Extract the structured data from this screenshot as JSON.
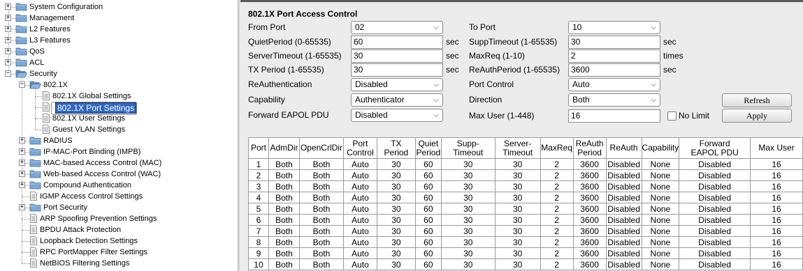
{
  "tree": {
    "items": [
      {
        "label": "System Configuration",
        "icon": "folder-icon"
      },
      {
        "label": "Management",
        "icon": "folder-icon"
      },
      {
        "label": "L2 Features",
        "icon": "folder-icon"
      },
      {
        "label": "L3 Features",
        "icon": "folder-icon"
      },
      {
        "label": "QoS",
        "icon": "folder-icon"
      },
      {
        "label": "ACL",
        "icon": "folder-icon"
      },
      {
        "label": "Security",
        "icon": "folder-open-icon"
      },
      {
        "label": "802.1X",
        "icon": "folder-open-icon"
      },
      {
        "label": "802.1X Global Settings",
        "icon": "document-icon"
      },
      {
        "label": "802.1X Port Settings",
        "icon": "document-icon"
      },
      {
        "label": "802.1X User Settings",
        "icon": "document-icon"
      },
      {
        "label": "Guest VLAN Settings",
        "icon": "document-icon"
      },
      {
        "label": "RADIUS",
        "icon": "folder-icon"
      },
      {
        "label": "IP-MAC-Port Binding (IMPB)",
        "icon": "folder-icon"
      },
      {
        "label": "MAC-based Access Control (MAC)",
        "icon": "folder-icon"
      },
      {
        "label": "Web-based Access Control (WAC)",
        "icon": "folder-icon"
      },
      {
        "label": "Compound Authentication",
        "icon": "folder-icon"
      },
      {
        "label": "IGMP Access Control Settings",
        "icon": "document-icon"
      },
      {
        "label": "Port Security",
        "icon": "folder-icon"
      },
      {
        "label": "ARP Spoofing Prevention Settings",
        "icon": "document-icon"
      },
      {
        "label": "BPDU Attack Protection",
        "icon": "document-icon"
      },
      {
        "label": "Loopback Detection Settings",
        "icon": "document-icon"
      },
      {
        "label": "RPC PortMapper Filter Settings",
        "icon": "document-icon"
      },
      {
        "label": "NetBIOS Filtering Settings",
        "icon": "document-icon"
      }
    ],
    "selected": "802.1X Port Settings"
  },
  "panel": {
    "title": "802.1X Port Access Control",
    "labels": {
      "from_port": "From Port",
      "to_port": "To Port",
      "quiet_period": "QuietPeriod (0-65535)",
      "supp_timeout": "SuppTimeout (1-65535)",
      "server_timeout": "ServerTimeout (1-65535)",
      "max_req": "MaxReq (1-10)",
      "tx_period": "TX Period (1-65535)",
      "reauth_period": "ReAuthPeriod (1-65535)",
      "reauthentication": "ReAuthentication",
      "port_control": "Port Control",
      "capability": "Capability",
      "direction": "Direction",
      "forward_eapol": "Forward EAPOL PDU",
      "max_user": "Max User (1-448)",
      "no_limit": "No Limit"
    },
    "values": {
      "from_port": "02",
      "to_port": "10",
      "quiet_period": "60",
      "supp_timeout": "30",
      "server_timeout": "30",
      "max_req": "2",
      "tx_period": "30",
      "reauth_period": "3600",
      "reauthentication": "Disabled",
      "port_control": "Auto",
      "capability": "Authenticator",
      "direction": "Both",
      "forward_eapol": "Disabled",
      "max_user": "16"
    },
    "units": {
      "sec": "sec",
      "times": "times"
    },
    "buttons": {
      "refresh": "Refresh",
      "apply": "Apply"
    }
  },
  "table": {
    "headers": [
      "Port",
      "AdmDir",
      "OpenCrlDir",
      "Port\nControl",
      "TX\nPeriod",
      "Quiet\nPeriod",
      "Supp-\nTimeout",
      "Server-\nTimeout",
      "MaxReq",
      "ReAuth\nPeriod",
      "ReAuth",
      "Capability",
      "Forward\nEAPOL PDU",
      "Max User"
    ],
    "rows": [
      [
        "1",
        "Both",
        "Both",
        "Auto",
        "30",
        "60",
        "30",
        "30",
        "2",
        "3600",
        "Disabled",
        "None",
        "Disabled",
        "16"
      ],
      [
        "2",
        "Both",
        "Both",
        "Auto",
        "30",
        "60",
        "30",
        "30",
        "2",
        "3600",
        "Disabled",
        "None",
        "Disabled",
        "16"
      ],
      [
        "3",
        "Both",
        "Both",
        "Auto",
        "30",
        "60",
        "30",
        "30",
        "2",
        "3600",
        "Disabled",
        "None",
        "Disabled",
        "16"
      ],
      [
        "4",
        "Both",
        "Both",
        "Auto",
        "30",
        "60",
        "30",
        "30",
        "2",
        "3600",
        "Disabled",
        "None",
        "Disabled",
        "16"
      ],
      [
        "5",
        "Both",
        "Both",
        "Auto",
        "30",
        "60",
        "30",
        "30",
        "2",
        "3600",
        "Disabled",
        "None",
        "Disabled",
        "16"
      ],
      [
        "6",
        "Both",
        "Both",
        "Auto",
        "30",
        "60",
        "30",
        "30",
        "2",
        "3600",
        "Disabled",
        "None",
        "Disabled",
        "16"
      ],
      [
        "7",
        "Both",
        "Both",
        "Auto",
        "30",
        "60",
        "30",
        "30",
        "2",
        "3600",
        "Disabled",
        "None",
        "Disabled",
        "16"
      ],
      [
        "8",
        "Both",
        "Both",
        "Auto",
        "30",
        "60",
        "30",
        "30",
        "2",
        "3600",
        "Disabled",
        "None",
        "Disabled",
        "16"
      ],
      [
        "9",
        "Both",
        "Both",
        "Auto",
        "30",
        "60",
        "30",
        "30",
        "2",
        "3600",
        "Disabled",
        "None",
        "Disabled",
        "16"
      ],
      [
        "10",
        "Both",
        "Both",
        "Auto",
        "30",
        "60",
        "30",
        "30",
        "2",
        "3600",
        "Disabled",
        "None",
        "Disabled",
        "16"
      ]
    ]
  },
  "colors": {
    "selection": "#3168c4",
    "panel_bg": "#ebebeb",
    "folder": "#7aa7d6"
  }
}
